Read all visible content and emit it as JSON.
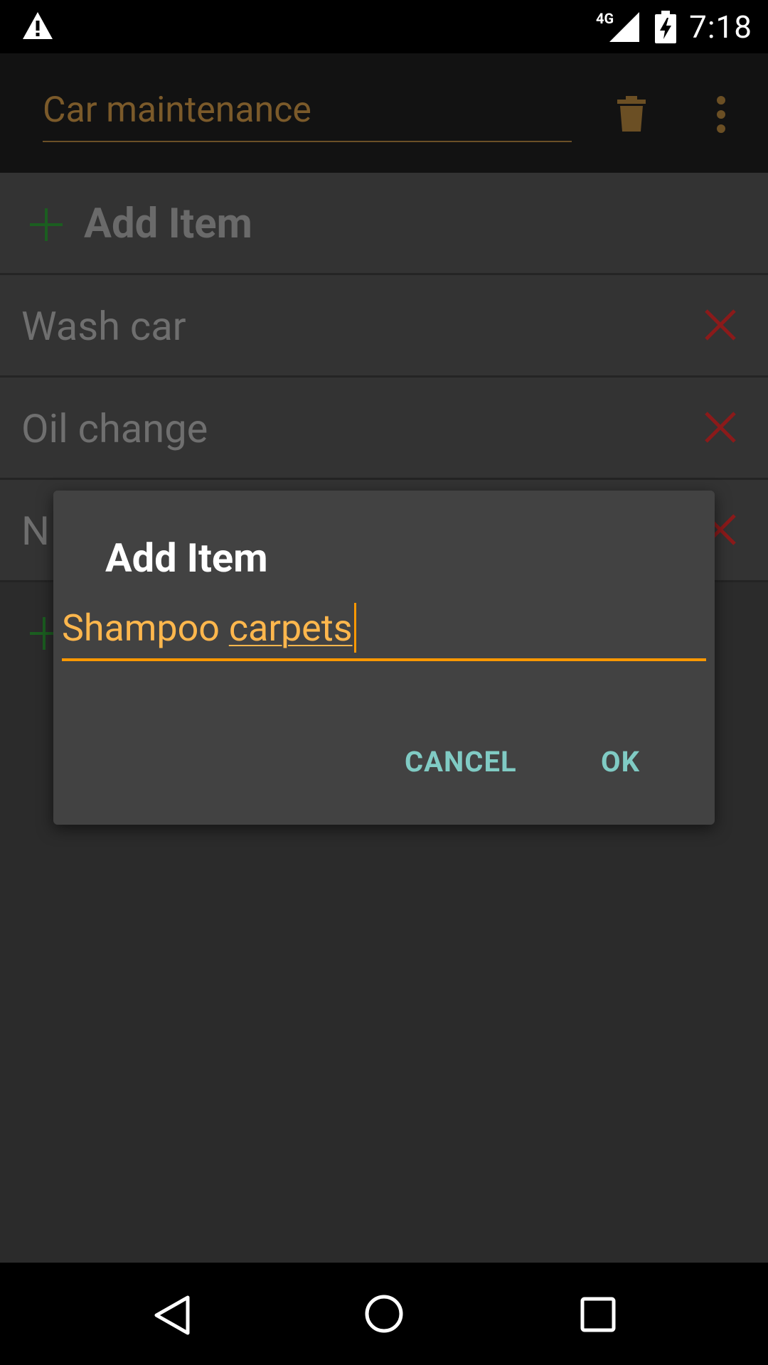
{
  "status_bar": {
    "network": "4G",
    "time": "7:18",
    "icons": [
      "warning-icon",
      "signal-icon",
      "battery-charging-icon"
    ]
  },
  "app_bar": {
    "title_value": "Car maintenance",
    "icons": [
      "trash-icon",
      "more-vert-icon"
    ]
  },
  "list": {
    "add_label": "Add Item",
    "items": [
      {
        "label": "Wash car"
      },
      {
        "label": "Oil change"
      },
      {
        "label": "N"
      }
    ]
  },
  "dialog": {
    "title": "Add Item",
    "input_value_plain": "Shampoo ",
    "input_value_composing": "carpets",
    "cancel_label": "CANCEL",
    "ok_label": "OK"
  },
  "nav_bar": {
    "icons": [
      "back-icon",
      "home-icon",
      "recents-icon"
    ]
  },
  "colors": {
    "accent": "#ff9800",
    "input_text": "#ffb74d",
    "button_text": "#80cbc4",
    "delete": "#b71c1c",
    "add_plus": "#1b5e20"
  }
}
